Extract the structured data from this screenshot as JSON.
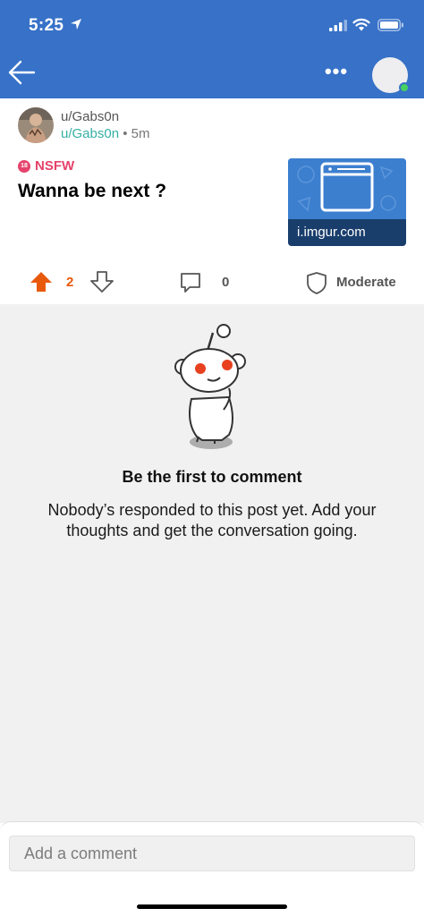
{
  "status_bar": {
    "time": "5:25"
  },
  "post": {
    "author_handle": "u/Gabs0n",
    "author_link": "u/Gabs0n",
    "age": "5m",
    "nsfw_label": "NSFW",
    "title": "Wanna be next ?",
    "link_domain": "i.imgur.com",
    "vote_count": "2",
    "comment_count": "0",
    "moderate_label": "Moderate"
  },
  "empty_state": {
    "title": "Be the first to comment",
    "body": "Nobody’s responded to this post yet. Add your thoughts and get the conversation going."
  },
  "composer": {
    "placeholder": "Add a comment"
  },
  "colors": {
    "header": "#3771c8",
    "upvote": "#e8590c",
    "nsfw": "#e5436b",
    "online": "#46d160",
    "link": "#35b0a4"
  }
}
